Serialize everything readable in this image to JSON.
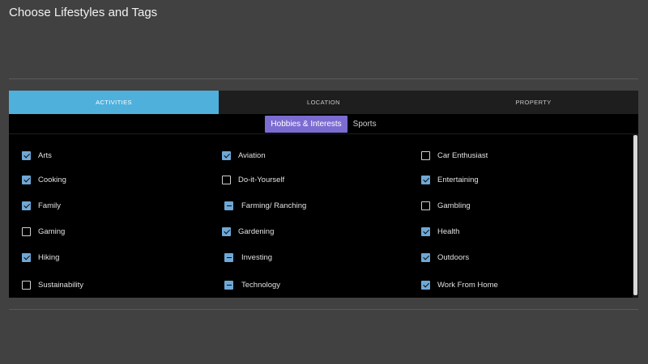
{
  "page": {
    "title": "Choose Lifestyles and Tags"
  },
  "tabs": [
    {
      "label": "ACTIVITIES",
      "active": true
    },
    {
      "label": "LOCATION",
      "active": false
    },
    {
      "label": "PROPERTY",
      "active": false
    }
  ],
  "subtabs": [
    {
      "label": "Hobbies & Interests",
      "active": true
    },
    {
      "label": "Sports",
      "active": false
    }
  ],
  "items": [
    {
      "label": "Arts",
      "state": "checked"
    },
    {
      "label": "Aviation",
      "state": "checked"
    },
    {
      "label": "Car Enthusiast",
      "state": "unchecked"
    },
    {
      "label": "Cooking",
      "state": "checked"
    },
    {
      "label": "Do-it-Yourself",
      "state": "unchecked"
    },
    {
      "label": "Entertaining",
      "state": "checked"
    },
    {
      "label": "Family",
      "state": "checked"
    },
    {
      "label": "Farming/ Ranching",
      "state": "partial"
    },
    {
      "label": "Gambling",
      "state": "unchecked"
    },
    {
      "label": "Gaming",
      "state": "unchecked"
    },
    {
      "label": "Gardening",
      "state": "checked"
    },
    {
      "label": "Health",
      "state": "checked"
    },
    {
      "label": "Hiking",
      "state": "checked"
    },
    {
      "label": "Investing",
      "state": "partial"
    },
    {
      "label": "Outdoors",
      "state": "checked"
    },
    {
      "label": "Sustainability",
      "state": "unchecked"
    },
    {
      "label": "Technology",
      "state": "partial"
    },
    {
      "label": "Work From Home",
      "state": "checked"
    }
  ],
  "colors": {
    "background": "#414141",
    "panel": "#000000",
    "tab_active": "#4fb0dc",
    "subtab_active": "#7b6cd1",
    "checkbox_checked": "#6fa8d6"
  },
  "icons": {
    "checked": "checkbox-checked-icon",
    "unchecked": "checkbox-unchecked-icon",
    "partial": "checkbox-indeterminate-icon"
  }
}
